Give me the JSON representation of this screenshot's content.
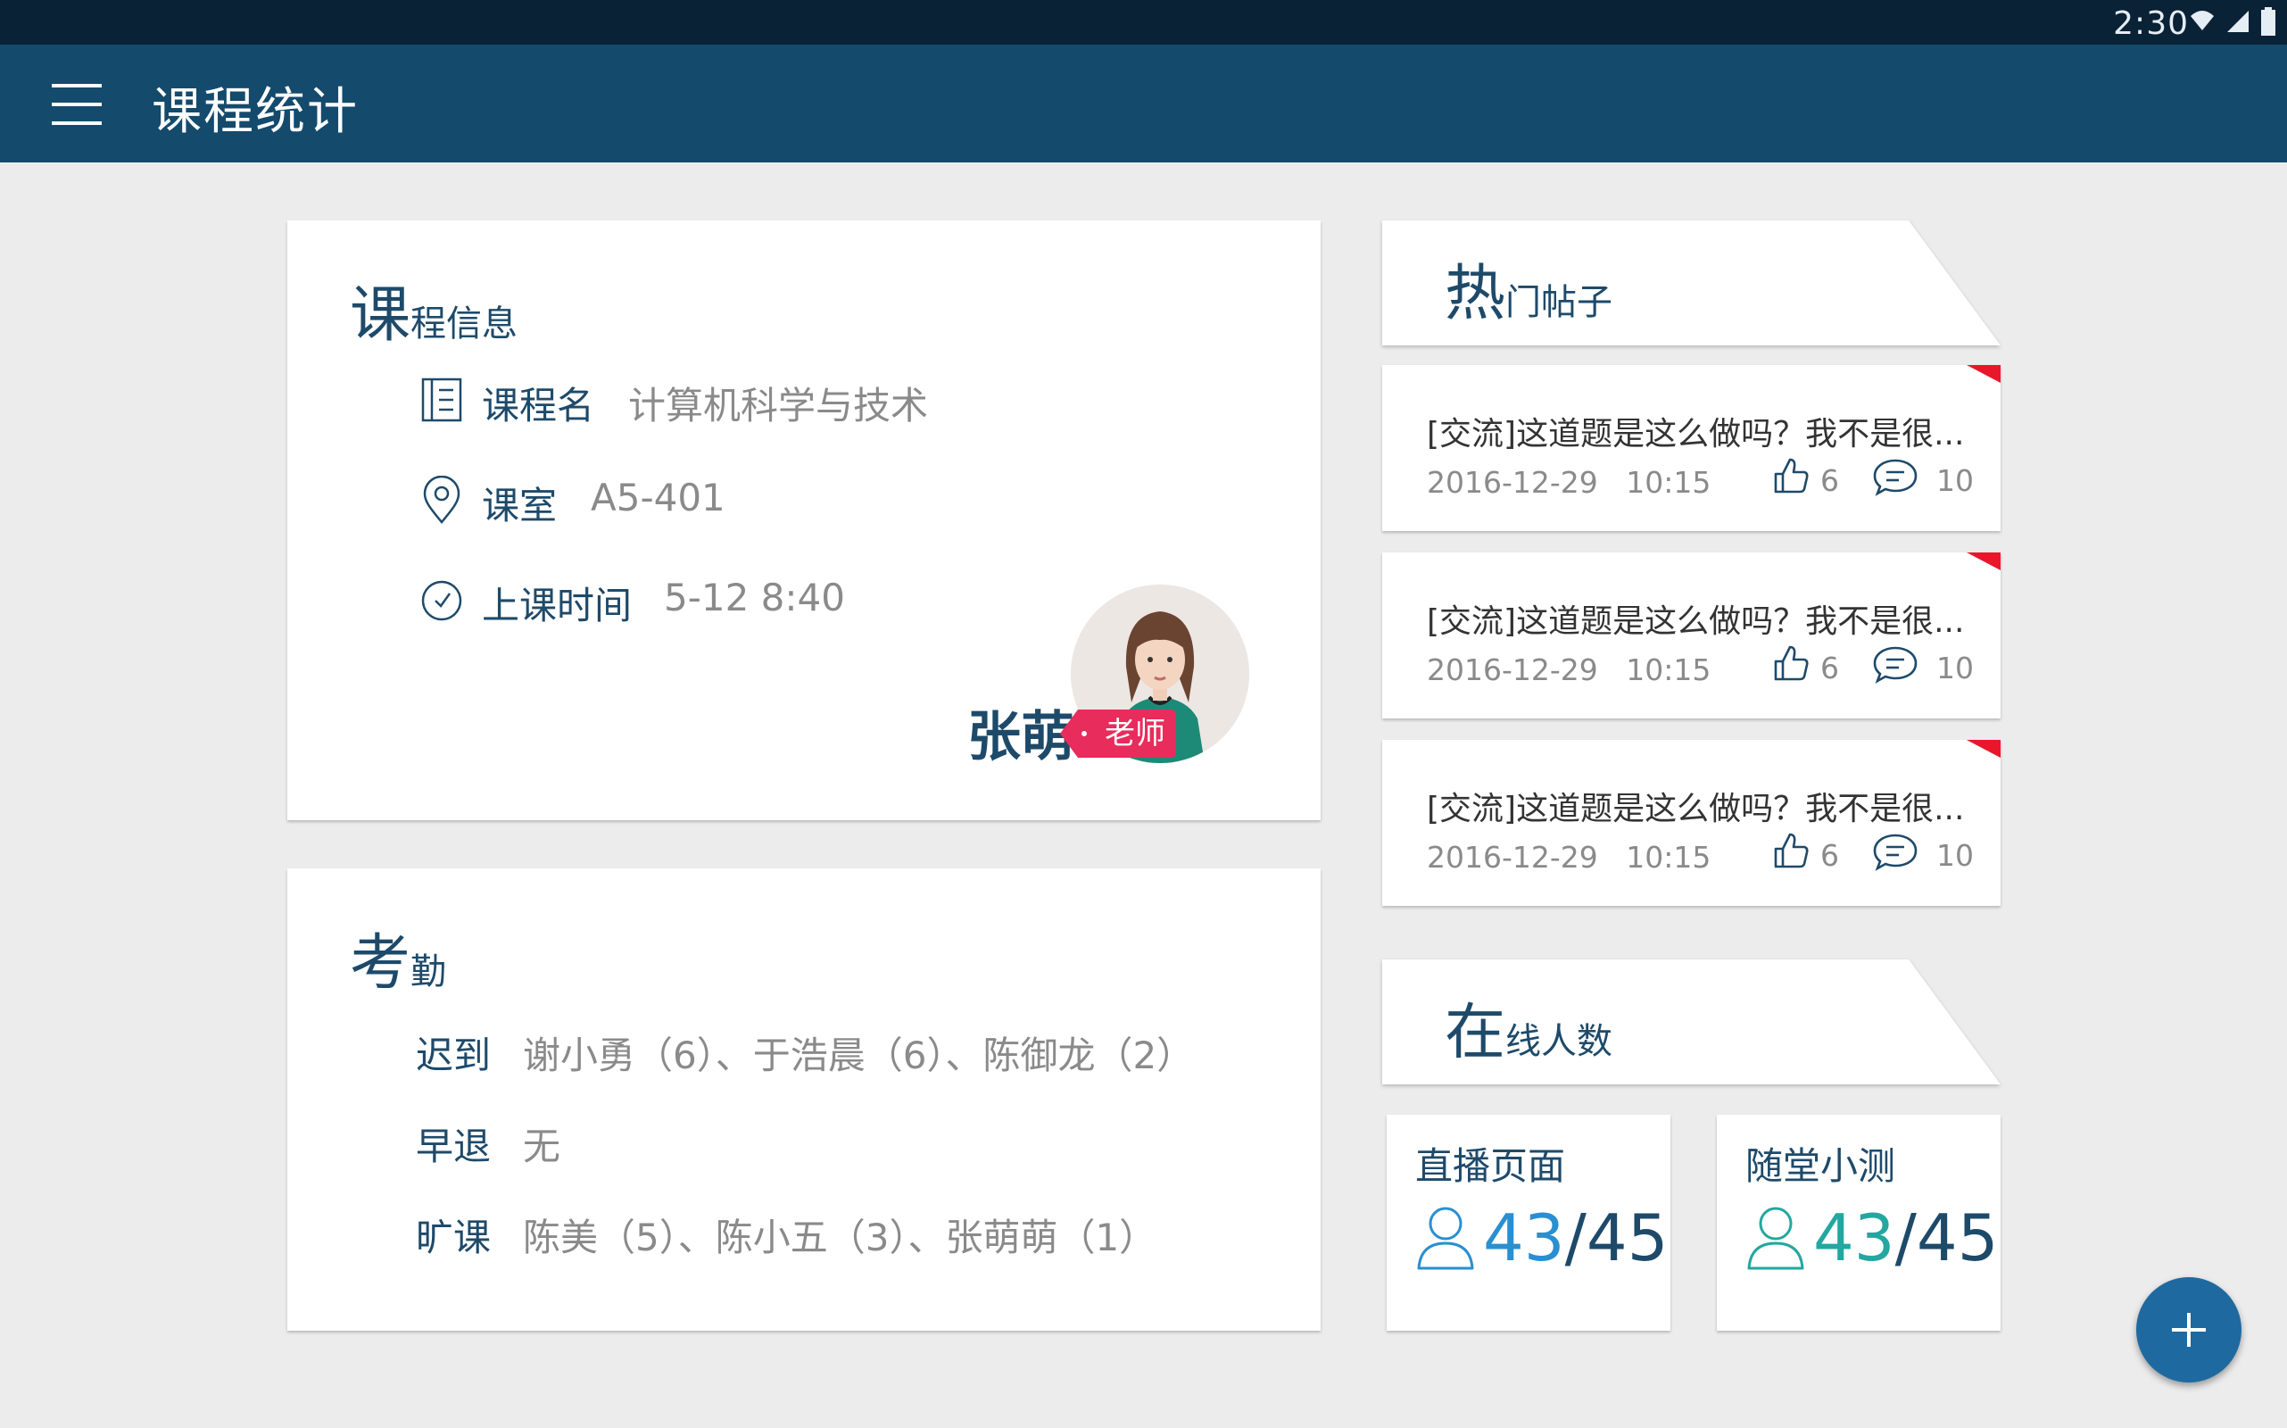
{
  "status_bar": {
    "time": "2:30",
    "icons": [
      "wifi-icon",
      "signal-icon",
      "battery-icon"
    ]
  },
  "app_bar": {
    "title": "课程统计",
    "menu_icon": "hamburger-menu-icon"
  },
  "course_info": {
    "title_first": "课",
    "title_rest": "程信息",
    "rows": [
      {
        "icon": "document-icon",
        "label": "课程名",
        "value": "计算机科学与技术"
      },
      {
        "icon": "location-pin-icon",
        "label": "课室",
        "value": "A5-401"
      },
      {
        "icon": "clock-icon",
        "label": "上课时间",
        "value": "5-12 8:40"
      }
    ],
    "teacher": {
      "name": "张萌",
      "tag": "老师"
    }
  },
  "attendance": {
    "title_first": "考",
    "title_rest": "勤",
    "rows": [
      {
        "label": "迟到",
        "value": "谢小勇（6）、于浩晨（6）、陈御龙（2）"
      },
      {
        "label": "早退",
        "value": "无"
      },
      {
        "label": "旷课",
        "value": "陈美（5）、陈小五（3）、张萌萌（1）"
      }
    ]
  },
  "hot_posts": {
    "title_first": "热",
    "title_rest": "门帖子",
    "posts": [
      {
        "title": "[交流]这道题是这么做吗？我不是很...",
        "date": "2016-12-29",
        "time": "10:15",
        "likes": "6",
        "comments": "10"
      },
      {
        "title": "[交流]这道题是这么做吗？我不是很...",
        "date": "2016-12-29",
        "time": "10:15",
        "likes": "6",
        "comments": "10"
      },
      {
        "title": "[交流]这道题是这么做吗？我不是很...",
        "date": "2016-12-29",
        "time": "10:15",
        "likes": "6",
        "comments": "10"
      }
    ]
  },
  "online": {
    "title_first": "在",
    "title_rest": "线人数",
    "stats": [
      {
        "label": "直播页面",
        "current": "43",
        "total": "45",
        "accent": "#2a8fd0"
      },
      {
        "label": "随堂小测",
        "current": "43",
        "total": "45",
        "accent": "#23a7a0"
      }
    ]
  },
  "fab": {
    "icon": "plus-icon"
  },
  "colors": {
    "app_bar": "#144a6c",
    "status_bar": "#0a2236",
    "tag": "#e82c5c",
    "hot_corner": "#e8172c",
    "fab": "#1e6aa0"
  }
}
